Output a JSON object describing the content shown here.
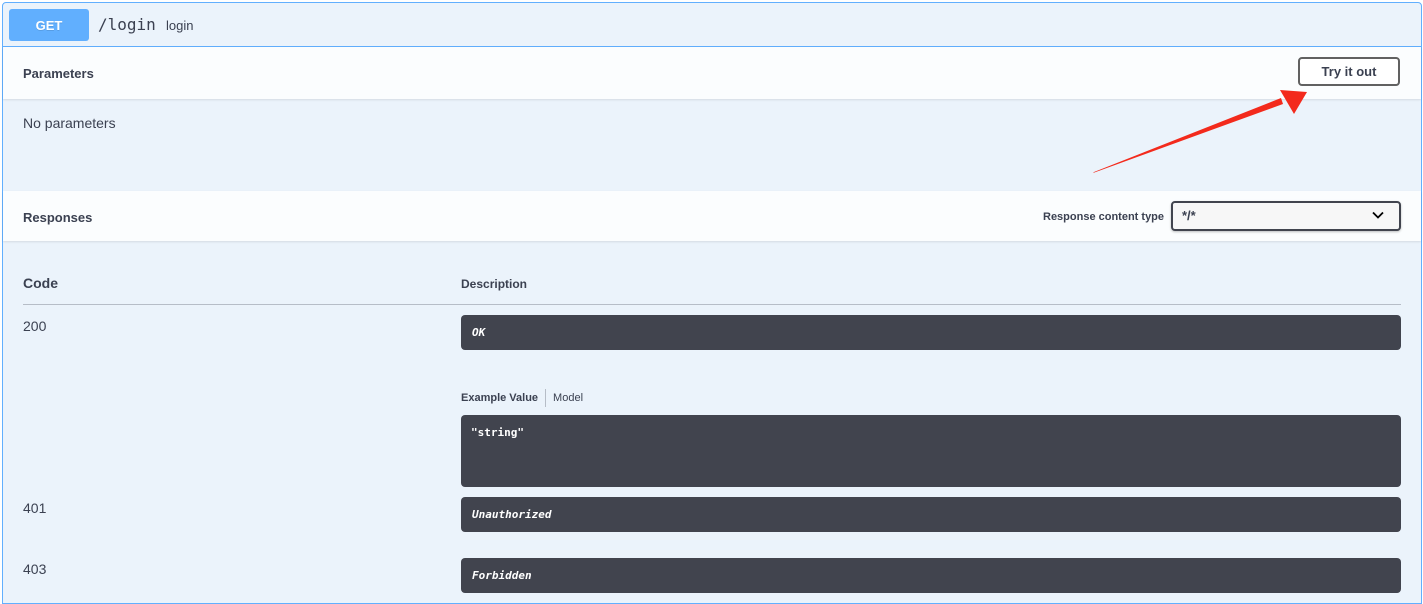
{
  "operation": {
    "method": "GET",
    "path": "/login",
    "summary": "login"
  },
  "parameters": {
    "title": "Parameters",
    "try_label": "Try it out",
    "empty_text": "No parameters"
  },
  "responses": {
    "title": "Responses",
    "content_type_label": "Response content type",
    "content_type_value": "*/*",
    "columns": {
      "code": "Code",
      "description": "Description"
    },
    "rows": [
      {
        "code": "200",
        "description": "OK"
      },
      {
        "code": "401",
        "description": "Unauthorized"
      },
      {
        "code": "403",
        "description": "Forbidden"
      }
    ],
    "example_tabs": {
      "example": "Example Value",
      "model": "Model"
    },
    "example_value": "\"string\""
  },
  "colors": {
    "get_accent": "#61affe",
    "block_bg": "#ebf3fb",
    "code_box_bg": "#41444e",
    "annotation_arrow": "#f32a1c"
  },
  "icons": {
    "select_chevron": "chevron-down-icon",
    "annotation": "red-arrow-annotation"
  }
}
